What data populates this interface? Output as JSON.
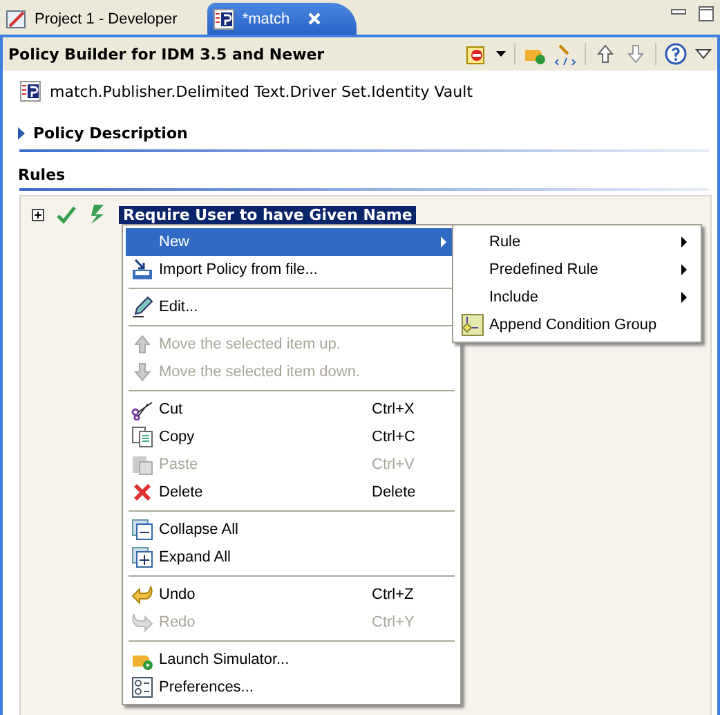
{
  "tabs": [
    {
      "label": "Project 1 - Developer",
      "selected": false
    },
    {
      "label": "*match",
      "selected": true,
      "closable": true
    }
  ],
  "editor": {
    "title": "Policy Builder for IDM 3.5 and Newer",
    "path": "match.Publisher.Delimited Text.Driver Set.Identity Vault",
    "sections": [
      {
        "label": "Policy Description",
        "expandable": true
      },
      {
        "label": "Rules",
        "expandable": false
      }
    ],
    "rules": [
      {
        "label": "Require User to have Given Name",
        "selected": true,
        "expanded": false,
        "enabled": true
      }
    ]
  },
  "context_menu": {
    "items": [
      {
        "kind": "item",
        "label": "New",
        "submenu": true,
        "selected": true,
        "disabled": false
      },
      {
        "kind": "item",
        "label": "Import Policy from file...",
        "selected": false,
        "disabled": false
      },
      {
        "kind": "separator"
      },
      {
        "kind": "item",
        "label": "Edit...",
        "selected": false,
        "disabled": false
      },
      {
        "kind": "separator"
      },
      {
        "kind": "item",
        "label": "Move the selected item up.",
        "selected": false,
        "disabled": true
      },
      {
        "kind": "item",
        "label": "Move the selected item down.",
        "selected": false,
        "disabled": true
      },
      {
        "kind": "separator"
      },
      {
        "kind": "item",
        "label": "Cut",
        "shortcut": "Ctrl+X",
        "selected": false,
        "disabled": false
      },
      {
        "kind": "item",
        "label": "Copy",
        "shortcut": "Ctrl+C",
        "selected": false,
        "disabled": false
      },
      {
        "kind": "item",
        "label": "Paste",
        "shortcut": "Ctrl+V",
        "selected": false,
        "disabled": true
      },
      {
        "kind": "item",
        "label": "Delete",
        "shortcut": "Delete",
        "selected": false,
        "disabled": false
      },
      {
        "kind": "separator"
      },
      {
        "kind": "item",
        "label": "Collapse All",
        "selected": false,
        "disabled": false
      },
      {
        "kind": "item",
        "label": "Expand All",
        "selected": false,
        "disabled": false
      },
      {
        "kind": "separator"
      },
      {
        "kind": "item",
        "label": "Undo",
        "shortcut": "Ctrl+Z",
        "selected": false,
        "disabled": false
      },
      {
        "kind": "item",
        "label": "Redo",
        "shortcut": "Ctrl+Y",
        "selected": false,
        "disabled": true
      },
      {
        "kind": "separator"
      },
      {
        "kind": "item",
        "label": "Launch Simulator...",
        "selected": false,
        "disabled": false
      },
      {
        "kind": "item",
        "label": "Preferences...",
        "selected": false,
        "disabled": false
      }
    ]
  },
  "submenu": {
    "items": [
      {
        "label": "Rule",
        "submenu": true
      },
      {
        "label": "Predefined Rule",
        "submenu": true
      },
      {
        "label": "Include",
        "submenu": true
      },
      {
        "label": "Append Condition Group",
        "submenu": false
      }
    ]
  }
}
